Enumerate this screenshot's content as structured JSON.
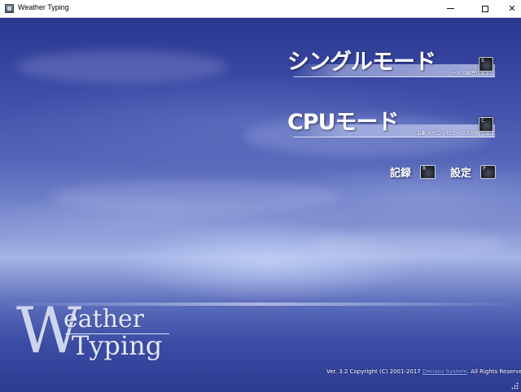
{
  "window": {
    "title": "Weather Typing",
    "icon": "app-icon",
    "controls": {
      "minimize": "minimize-icon",
      "maximize": "maximize-icon",
      "close": "✕"
    }
  },
  "menu": {
    "single_mode": {
      "label": "シングルモード",
      "subtitle": "一人で練習します",
      "key": "S"
    },
    "cpu_mode": {
      "label": "CPUモード",
      "subtitle": "自動入力コンピュータと対戦します",
      "key": "C"
    },
    "record": {
      "label": "記録",
      "key": "R"
    },
    "settings": {
      "label": "設定",
      "key": "P"
    }
  },
  "logo": {
    "w": "W",
    "line1": "eather",
    "line2": "Typing"
  },
  "footer": {
    "prefix": "Ver. 3.2 Copyright (C) 2001-2017 ",
    "company": "Denasu System",
    "suffix": ". All Rights Reserved."
  }
}
